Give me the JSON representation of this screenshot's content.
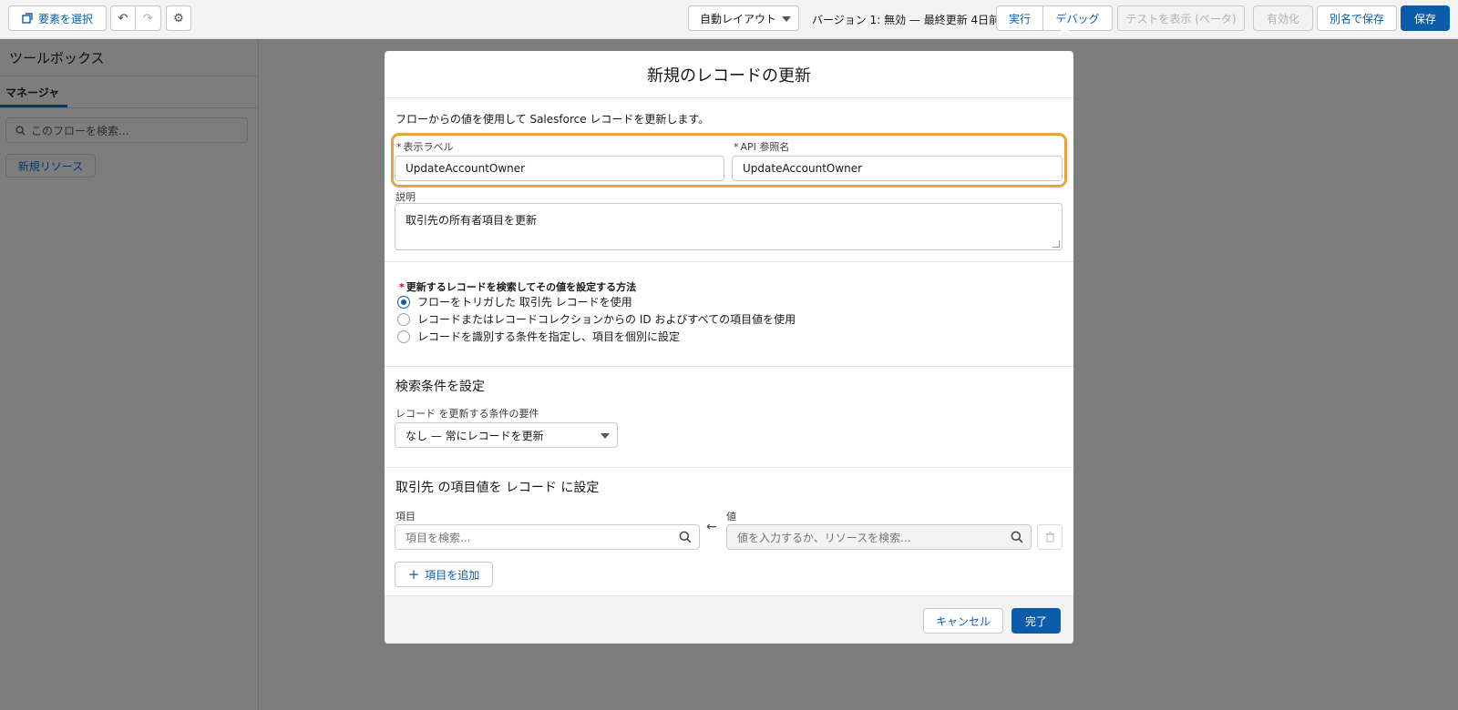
{
  "toolbar": {
    "select_elements_label": "要素を選択",
    "undo_icon": "undo-icon",
    "redo_icon": "redo-icon",
    "settings_icon": "gear-icon",
    "layout_select_value": "自動レイアウト",
    "version_text": "バージョン 1: 無効 — 最終更新 4日前",
    "run_label": "実行",
    "debug_label": "デバッグ",
    "view_tests_label": "テストを表示 (ベータ)",
    "activate_label": "有効化",
    "save_as_label": "別名で保存",
    "save_label": "保存"
  },
  "toolbox": {
    "title": "ツールボックス",
    "tab_manager": "マネージャ",
    "search_placeholder": "このフローを検索...",
    "new_resource_label": "新規リソース"
  },
  "modal": {
    "title": "新規のレコードの更新",
    "intro": "フローからの値を使用して Salesforce レコードを更新します。",
    "label_field": {
      "label": "表示ラベル",
      "value": "UpdateAccountOwner"
    },
    "api_field": {
      "label": "API 参照名",
      "value": "UpdateAccountOwner"
    },
    "description": {
      "label": "説明",
      "value": "取引先の所有者項目を更新"
    },
    "method": {
      "title": "更新するレコードを検索してその値を設定する方法",
      "options": [
        {
          "label": "フローをトリガした 取引先 レコードを使用",
          "checked": true
        },
        {
          "label": "レコードまたはレコードコレクションからの ID およびすべての項目値を使用",
          "checked": false
        },
        {
          "label": "レコードを識別する条件を指定し、項目を個別に設定",
          "checked": false
        }
      ]
    },
    "criteria": {
      "heading": "検索条件を設定",
      "label": "レコード を更新する条件の要件",
      "value": "なし — 常にレコードを更新"
    },
    "set_fields": {
      "heading": "取引先 の項目値を レコード に設定",
      "field_label": "項目",
      "field_placeholder": "項目を検索...",
      "value_label": "値",
      "value_placeholder": "値を入力するか、リソースを検索...",
      "add_field_label": "項目を追加"
    },
    "footer": {
      "cancel_label": "キャンセル",
      "done_label": "完了"
    }
  },
  "colors": {
    "brand": "#0b5cab",
    "highlight": "#e8a33d",
    "required": "#ba0517"
  }
}
